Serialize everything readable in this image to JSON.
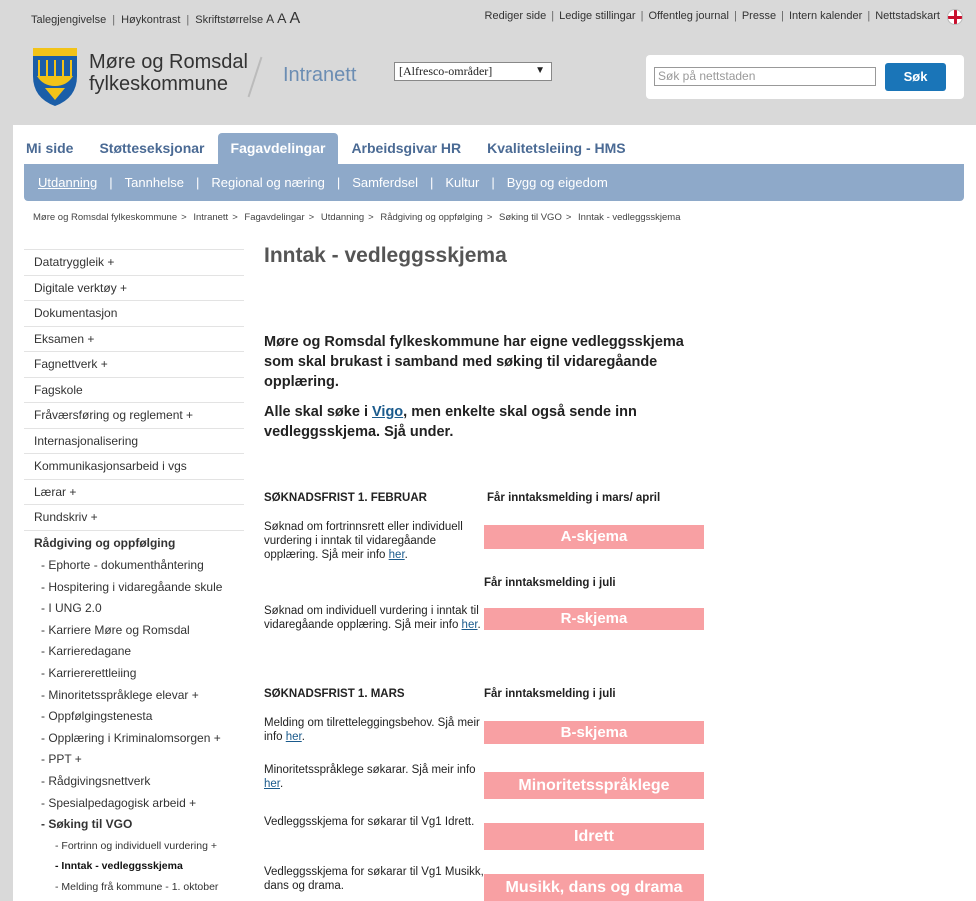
{
  "util_left": {
    "links": [
      "Talegjengivelse",
      "Høykontrast",
      "Skriftstørrelse"
    ],
    "font_a": [
      "A",
      "A",
      "A"
    ]
  },
  "util_right": {
    "links": [
      "Rediger side",
      "Ledige stillingar",
      "Offentleg journal",
      "Presse",
      "Intern kalender",
      "Nettstadskart"
    ]
  },
  "header": {
    "org_line1": "Møre og Romsdal",
    "org_line2": "fylkeskommune",
    "intranett": "Intranett",
    "select_value": "[Alfresco-områder]",
    "search_placeholder": "Søk på nettstaden",
    "search_button": "Søk"
  },
  "tabs": [
    "Mi side",
    "Støtteseksjonar",
    "Fagavdelingar",
    "Arbeidsgivar HR",
    "Kvalitetsleiing - HMS"
  ],
  "subnav": [
    "Utdanning",
    "Tannhelse",
    "Regional og næring",
    "Samferdsel",
    "Kultur",
    "Bygg og eigedom"
  ],
  "breadcrumb": [
    "Møre og Romsdal fylkeskommune",
    "Intranett",
    "Fagavdelingar",
    "Utdanning",
    "Rådgiving og oppfølging",
    "Søking til VGO",
    "Inntak - vedleggsskjema"
  ],
  "sidebar": {
    "items": [
      "Datatryggleik +",
      "Digitale verktøy +",
      "Dokumentasjon",
      "Eksamen +",
      "Fagnettverk +",
      "Fagskole",
      "Fråværsføring og reglement +",
      "Internasjonalisering",
      "Kommunikasjonsarbeid i vgs",
      "Lærar +",
      "Rundskriv +",
      "Rådgiving og oppfølging"
    ],
    "sub": [
      "- Ephorte - dokumenthåntering",
      "- Hospitering i vidaregåande skule",
      "- I UNG 2.0",
      "- Karriere Møre og Romsdal",
      "- Karrieredagane",
      "- Karriererettleiing",
      "- Minoritetsspråklege elevar +",
      "- Oppfølgingstenesta",
      "- Opplæring i Kriminalomsorgen +",
      "- PPT +",
      "- Rådgivingsnettverk",
      "- Spesialpedagogisk arbeid +",
      "- Søking til VGO"
    ],
    "sub2": [
      "- Fortrinn og individuell vurdering +",
      "- Inntak - vedleggsskjema",
      "- Melding frå kommune - 1. oktober"
    ]
  },
  "content": {
    "title": "Inntak - vedleggsskjema",
    "intro1": "Møre og Romsdal fylkeskommune har eigne vedleggsskjema som skal brukast i samband med søking til vidaregåande opplæring.",
    "intro2_pre": "Alle skal søke i ",
    "intro2_link": "Vigo",
    "intro2_post": ", men enkelte skal også sende inn vedleggsskjema. Sjå under.",
    "sec1": "SØKNADSFRIST 1. FEBRUAR",
    "sec1_info": "Får inntaksmelding i mars/ april",
    "a_desc": "Søknad om fortrinnsrett eller individuell vurdering i inntak til vidaregåande opplæring. Sjå meir info ",
    "a_btn": "A-skjema",
    "r_info": "Får inntaksmelding i juli",
    "r_desc": "Søknad om individuell vurdering i inntak til vidaregåande opplæring. Sjå meir info ",
    "r_btn": "R-skjema",
    "sec2": "SØKNADSFRIST 1. MARS",
    "sec2_info": "Får inntaksmelding i juli",
    "b_desc": "Melding om tilretteleggingsbehov. Sjå meir info ",
    "b_btn": "B-skjema",
    "m_desc": "Minoritetsspråklege søkarar. Sjå meir info ",
    "m_btn": "Minoritetsspråklege",
    "i_desc": "Vedleggsskjema for søkarar til Vg1 Idrett.",
    "i_btn": "Idrett",
    "mu_desc": "Vedleggsskjema for søkarar til Vg1 Musikk, dans og drama.",
    "mu_btn": "Musikk, dans og drama",
    "her": "her",
    "dot": "."
  },
  "colors": {
    "accent_blue": "#1a75b8",
    "nav_blue": "#8ea9c9",
    "pink_button": "#f8a0a3"
  }
}
